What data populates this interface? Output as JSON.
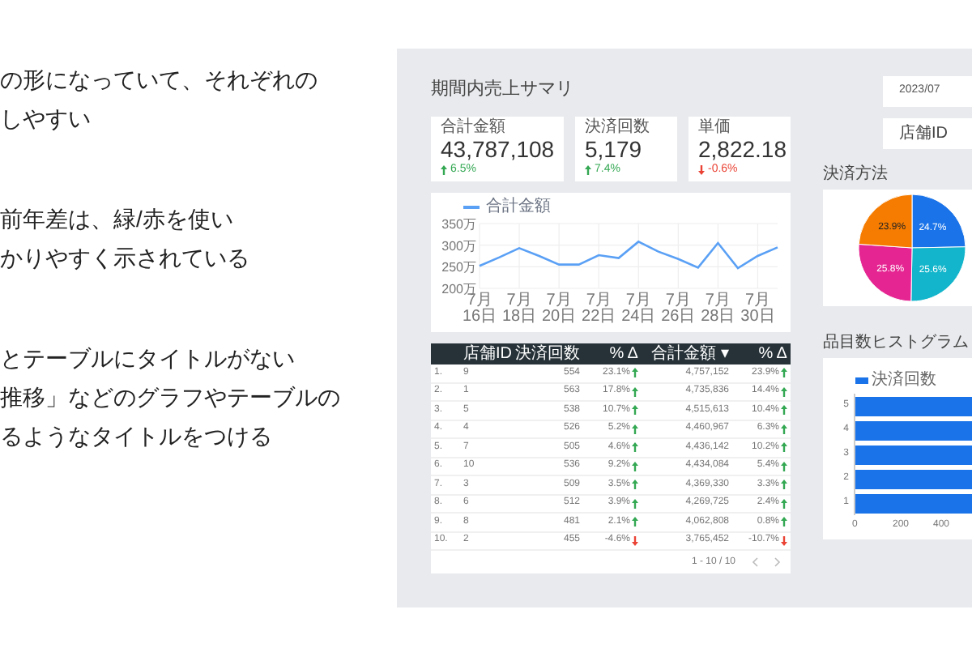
{
  "notes": [
    [
      "の形になっていて、それぞれの",
      "しやすい"
    ],
    [
      "前年差は、緑/赤を使い",
      "かりやすく示されている"
    ],
    [
      "とテーブルにタイトルがない",
      "推移」などのグラフやテーブルの",
      "るようなタイトルをつける"
    ]
  ],
  "dashboard": {
    "title": "期間内売上サマリ",
    "kpis": [
      {
        "label": "合計金額",
        "value": "43,787,108",
        "delta": "6.5%",
        "up": true
      },
      {
        "label": "決済回数",
        "value": "5,179",
        "delta": "7.4%",
        "up": true
      },
      {
        "label": "単価",
        "value": "2,822.18",
        "delta": "-0.6%",
        "up": false
      }
    ],
    "trend_chart": {
      "chart_data": {
        "type": "line",
        "categories": [
          "7月16日",
          null,
          "7月18日",
          null,
          "7月20日",
          null,
          "7月22日",
          null,
          "7月24日",
          null,
          "7月26日",
          null,
          "7月28日",
          null,
          "7月30日",
          null
        ],
        "series": [
          {
            "name": "合計金額",
            "color": "#5aa0f5",
            "values": [
              252,
              272,
              293,
              275,
              255,
              255,
              277,
              270,
              308,
              285,
              268,
              248,
              305,
              247,
              275,
              295
            ]
          }
        ],
        "ylim": [
          200,
          350
        ],
        "grid": true,
        "yticks": [
          {
            "value": 200,
            "label": "200万"
          },
          {
            "value": 250,
            "label": "250万"
          },
          {
            "value": 300,
            "label": "300万"
          },
          {
            "value": 350,
            "label": "350万"
          }
        ]
      }
    },
    "table": {
      "columns": [
        "店舗ID",
        "決済回数",
        "% Δ",
        "合計金額 ▾",
        "% Δ"
      ],
      "rows": [
        {
          "index": "1.",
          "store": "9",
          "count": "554",
          "count_delta": "23.1%",
          "count_up": true,
          "total": "4,757,152",
          "total_delta": "23.9%",
          "total_up": true
        },
        {
          "index": "2.",
          "store": "1",
          "count": "563",
          "count_delta": "17.8%",
          "count_up": true,
          "total": "4,735,836",
          "total_delta": "14.4%",
          "total_up": true
        },
        {
          "index": "3.",
          "store": "5",
          "count": "538",
          "count_delta": "10.7%",
          "count_up": true,
          "total": "4,515,613",
          "total_delta": "10.4%",
          "total_up": true
        },
        {
          "index": "4.",
          "store": "4",
          "count": "526",
          "count_delta": "5.2%",
          "count_up": true,
          "total": "4,460,967",
          "total_delta": "6.3%",
          "total_up": true
        },
        {
          "index": "5.",
          "store": "7",
          "count": "505",
          "count_delta": "4.6%",
          "count_up": true,
          "total": "4,436,142",
          "total_delta": "10.2%",
          "total_up": true
        },
        {
          "index": "6.",
          "store": "10",
          "count": "536",
          "count_delta": "9.2%",
          "count_up": true,
          "total": "4,434,084",
          "total_delta": "5.4%",
          "total_up": true
        },
        {
          "index": "7.",
          "store": "3",
          "count": "509",
          "count_delta": "3.5%",
          "count_up": true,
          "total": "4,369,330",
          "total_delta": "3.3%",
          "total_up": true
        },
        {
          "index": "8.",
          "store": "6",
          "count": "512",
          "count_delta": "3.9%",
          "count_up": true,
          "total": "4,269,725",
          "total_delta": "2.4%",
          "total_up": true
        },
        {
          "index": "9.",
          "store": "8",
          "count": "481",
          "count_delta": "2.1%",
          "count_up": true,
          "total": "4,062,808",
          "total_delta": "0.8%",
          "total_up": true
        },
        {
          "index": "10.",
          "store": "2",
          "count": "455",
          "count_delta": "-4.6%",
          "count_up": false,
          "total": "3,765,452",
          "total_delta": "-10.7%",
          "total_up": false
        }
      ],
      "pagination": "1 - 10 / 10"
    },
    "date_field": "2023/07",
    "store_field": "店舗ID",
    "payment": {
      "title": "決済方法",
      "chart_data": {
        "type": "pie",
        "values": [
          24.7,
          25.6,
          25.8,
          23.9
        ],
        "value_labels": [
          "24.7%",
          "25.6%",
          "25.8%",
          "23.9%"
        ]
      }
    },
    "histogram": {
      "title": "品目数ヒストグラム",
      "legend": "決済回数",
      "categories": [
        "5",
        "4",
        "3",
        "2",
        "1"
      ],
      "xticks": [
        "0",
        "200",
        "400"
      ]
    }
  }
}
